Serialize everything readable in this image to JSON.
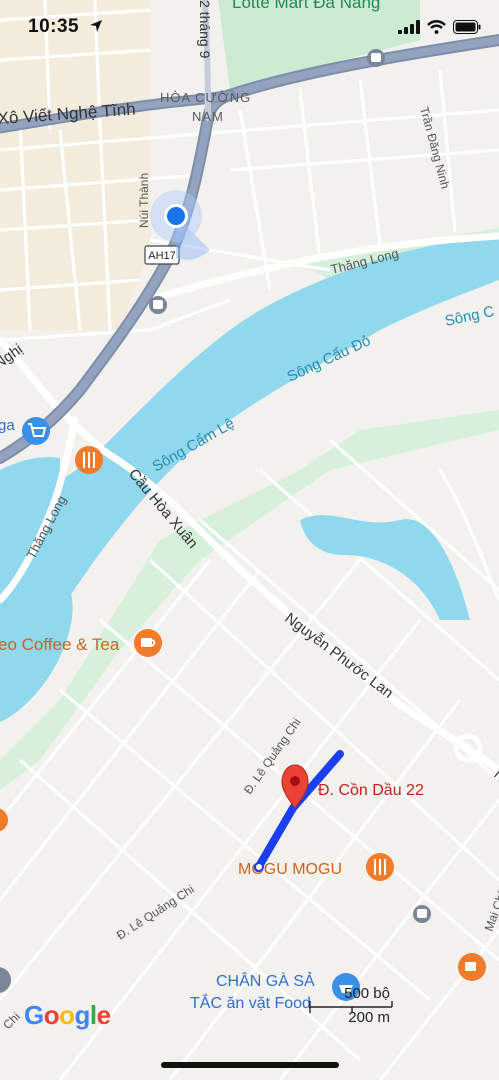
{
  "status_bar": {
    "time": "10:35"
  },
  "map": {
    "top_poi": "Lotte Mart Đà Nẵng",
    "district": [
      "HÒA CƯỜNG",
      "NAM"
    ],
    "roads": {
      "ko_viet_nghe_tinh": "Xô Viết Nghệ Tĩnh",
      "nui_thanh": "Núi Thành",
      "thang_9": "2 tháng 9",
      "tran_dang_ninh": "Trần Đăng Ninh",
      "thang_long_north": "Thăng Long",
      "thang_long_west": "Thăng Long",
      "nghi_partial": "Nghị",
      "cau_hoa_xuan": "Cầu Hòa Xuân",
      "nguyen_phuoc_lan": "Nguyễn Phước Lan",
      "le_quang_chi_1": "Đ. Lê Quảng Chi",
      "le_quang_chi_2": "Đ. Lê Quảng Chi",
      "mai_chi_partial": "Mai Chí",
      "chi_partial": "Chi",
      "n_partial": "N"
    },
    "highway_shield": "AH17",
    "rivers": {
      "song_cau_do": "Sông Cẩu Đỏ",
      "song_cam_le": "Sông Cẩm Lệ",
      "song_partial": "Sông C"
    },
    "pois": {
      "coffee": "eo Coffee & Tea",
      "destination": "Đ. Cồn Dầu 22",
      "mogu": "MOGU MOGU",
      "chan_ga_1": "CHÂN GÀ SẢ",
      "chan_ga_2": "TẮC ăn vặt Food",
      "ga_partial": "ga"
    },
    "colors": {
      "water": "#8fd8ee",
      "route": "#1a3ef0",
      "highway": "#8d9db9",
      "pin": "#ea4335",
      "poi_food": "#f07b2a",
      "poi_shop": "#3a8fe6",
      "location_dot": "#1a73e8"
    }
  },
  "branding": {
    "logo": "Google"
  },
  "scale": {
    "imperial": "500 bộ",
    "metric": "200 m"
  }
}
